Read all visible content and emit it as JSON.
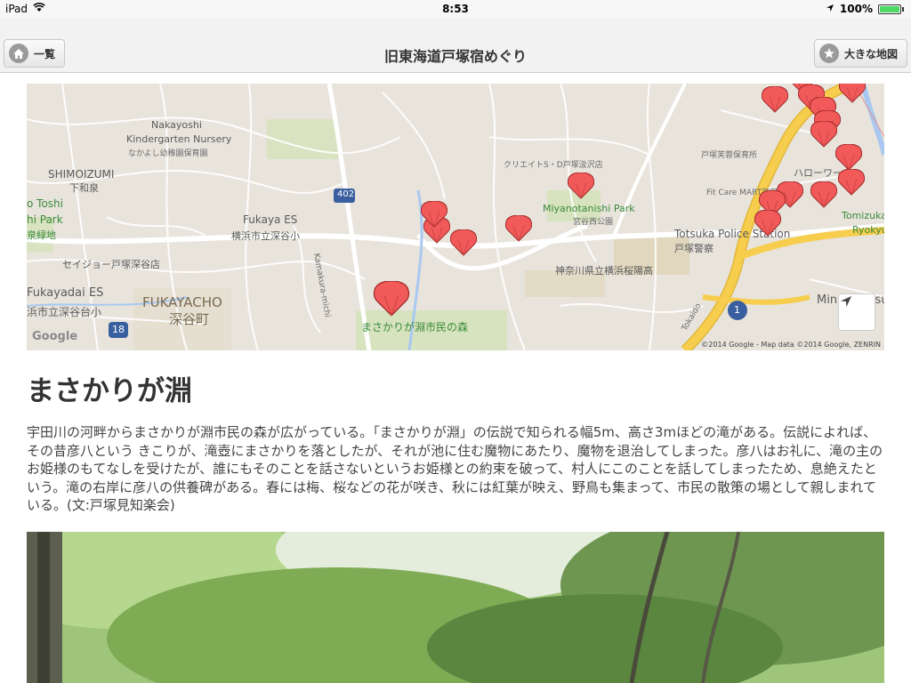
{
  "status": {
    "device": "iPad",
    "time": "8:53",
    "battery": "100%",
    "battery_level": 1.0
  },
  "nav": {
    "title": "旧東海道戸塚宿めぐり",
    "left_label": "一覧",
    "right_label": "大きな地図"
  },
  "map": {
    "labels": {
      "nakayoshi1": "Nakayoshi",
      "nakayoshi2": "Kindergarten Nursery",
      "nakayoshi3": "なかよし幼稚園保育園",
      "shimoizumi": "SHIMOIZUMI",
      "shimoizumi_jp": "下和泉",
      "toshi": "o Toshi",
      "hi_park": "hi Park",
      "ryokuchi": "泉緑地",
      "fukaya_es": "Fukaya ES",
      "fukaya_es_jp": "横浜市立深谷小",
      "seijo": "セイジョー戸塚深谷店",
      "fukayadai_es": "Fukayadai ES",
      "fukayadai_jp": "浜市立深谷台小",
      "fukayacho": "FUKAYACHO",
      "fukayacho_jp": "深谷町",
      "kamakura_michi": "Kamakura-michi",
      "road_402": "402",
      "creates": "クリエイトS・D戸塚汲沢店",
      "miyatani": "Miyanotanishi Park",
      "miyatani_jp": "宮谷西公園",
      "hoshien": "戸塚芙蓉保育所",
      "harowaku": "ハローワーク",
      "fitcare": "Fit Care MART戸塚町店",
      "tomizuka": "Tomizuka",
      "ryokyu": "Ryokyu",
      "totsuka_police": "Totsuka Police Station",
      "totsuka_police_jp": "戸塚警察",
      "oyo_koko": "神奈川県立横浜桜陽高",
      "masakari_forest": "まさかりが淵市民の森",
      "minamitotsuka": "Minamitotsuka",
      "route_18": "18",
      "route_1": "1",
      "tokaido": "Tokaido",
      "google": "Google",
      "attribution": "©2014 Google - Map data ©2014 Google, ZENRIN"
    }
  },
  "spot": {
    "title": "まさかりが淵",
    "description": "宇田川の河畔からまさかりが淵市民の森が広がっている。「まさかりが淵」の伝説で知られる幅5m、高さ3mほどの滝がある。伝説によれば、その昔彦八という きこりが、滝壺にまさかりを落としたが、それが池に住む魔物にあたり、魔物を退治してしまった。彦八はお礼に、滝の主のお姫様のもてなしを受けたが、誰にもそのことを話さないというお姫様との約束を破って、村人にこのことを話してしまったため、息絶えたという。滝の右岸に彦八の供養碑がある。春には梅、桜などの花が咲き、秋には紅葉が映え、野鳥も集まって、市民の散策の場として親しまれている。(文:戸塚見知楽会)"
  },
  "colors": {
    "marker": "#f25a5a",
    "highway": "#f7cd4d",
    "map_bg": "#e8e4dc",
    "park": "#cfe3b0",
    "water": "#a9c8f0"
  }
}
